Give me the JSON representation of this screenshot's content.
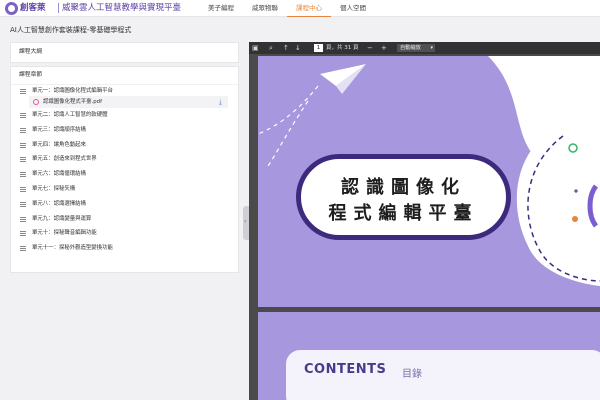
{
  "header": {
    "brand": "創客萊",
    "site_title": "威聚雲人工智慧教學與實現平臺",
    "nav": [
      "美子編程",
      "威眾物聯",
      "課程中心",
      "個人空間"
    ],
    "active_nav": "課程中心"
  },
  "course": {
    "title": "AI人工智慧創作套裝課程-零基礎學程式"
  },
  "outline": {
    "label": "課程大綱"
  },
  "chapters": {
    "label": "課程章節",
    "units": [
      "單元一：認識圖像化程式編輯平台",
      "單元二：認識人工智慧的軟硬體",
      "單元三：認識順序結構",
      "單元四：讓角色動起來",
      "單元五：創造來到程式世界",
      "單元六：認識循環結構",
      "單元七：探秘矢構",
      "單元八：認識選擇結構",
      "單元九：認識變量與運算",
      "單元十：探秘聲音編輯功能",
      "單元十一：探秘外觀造型變換功能"
    ],
    "file": {
      "name": "認識圖像化程式平臺.pdf",
      "icon": "pdf-file-icon"
    }
  },
  "viewer": {
    "page_current": "1",
    "page_count": "頁，共 31 頁",
    "zoom": "自動縮放",
    "slide_title_line1": "認識圖像化",
    "slide_title_line2": "程式編輯平臺",
    "contents_title": "CONTENTS",
    "contents_sub": "目錄"
  },
  "colors": {
    "brand": "#5a3fa8",
    "accent": "#e8853a",
    "slide_bg": "#a797de",
    "slide_border": "#3d2a7d"
  }
}
